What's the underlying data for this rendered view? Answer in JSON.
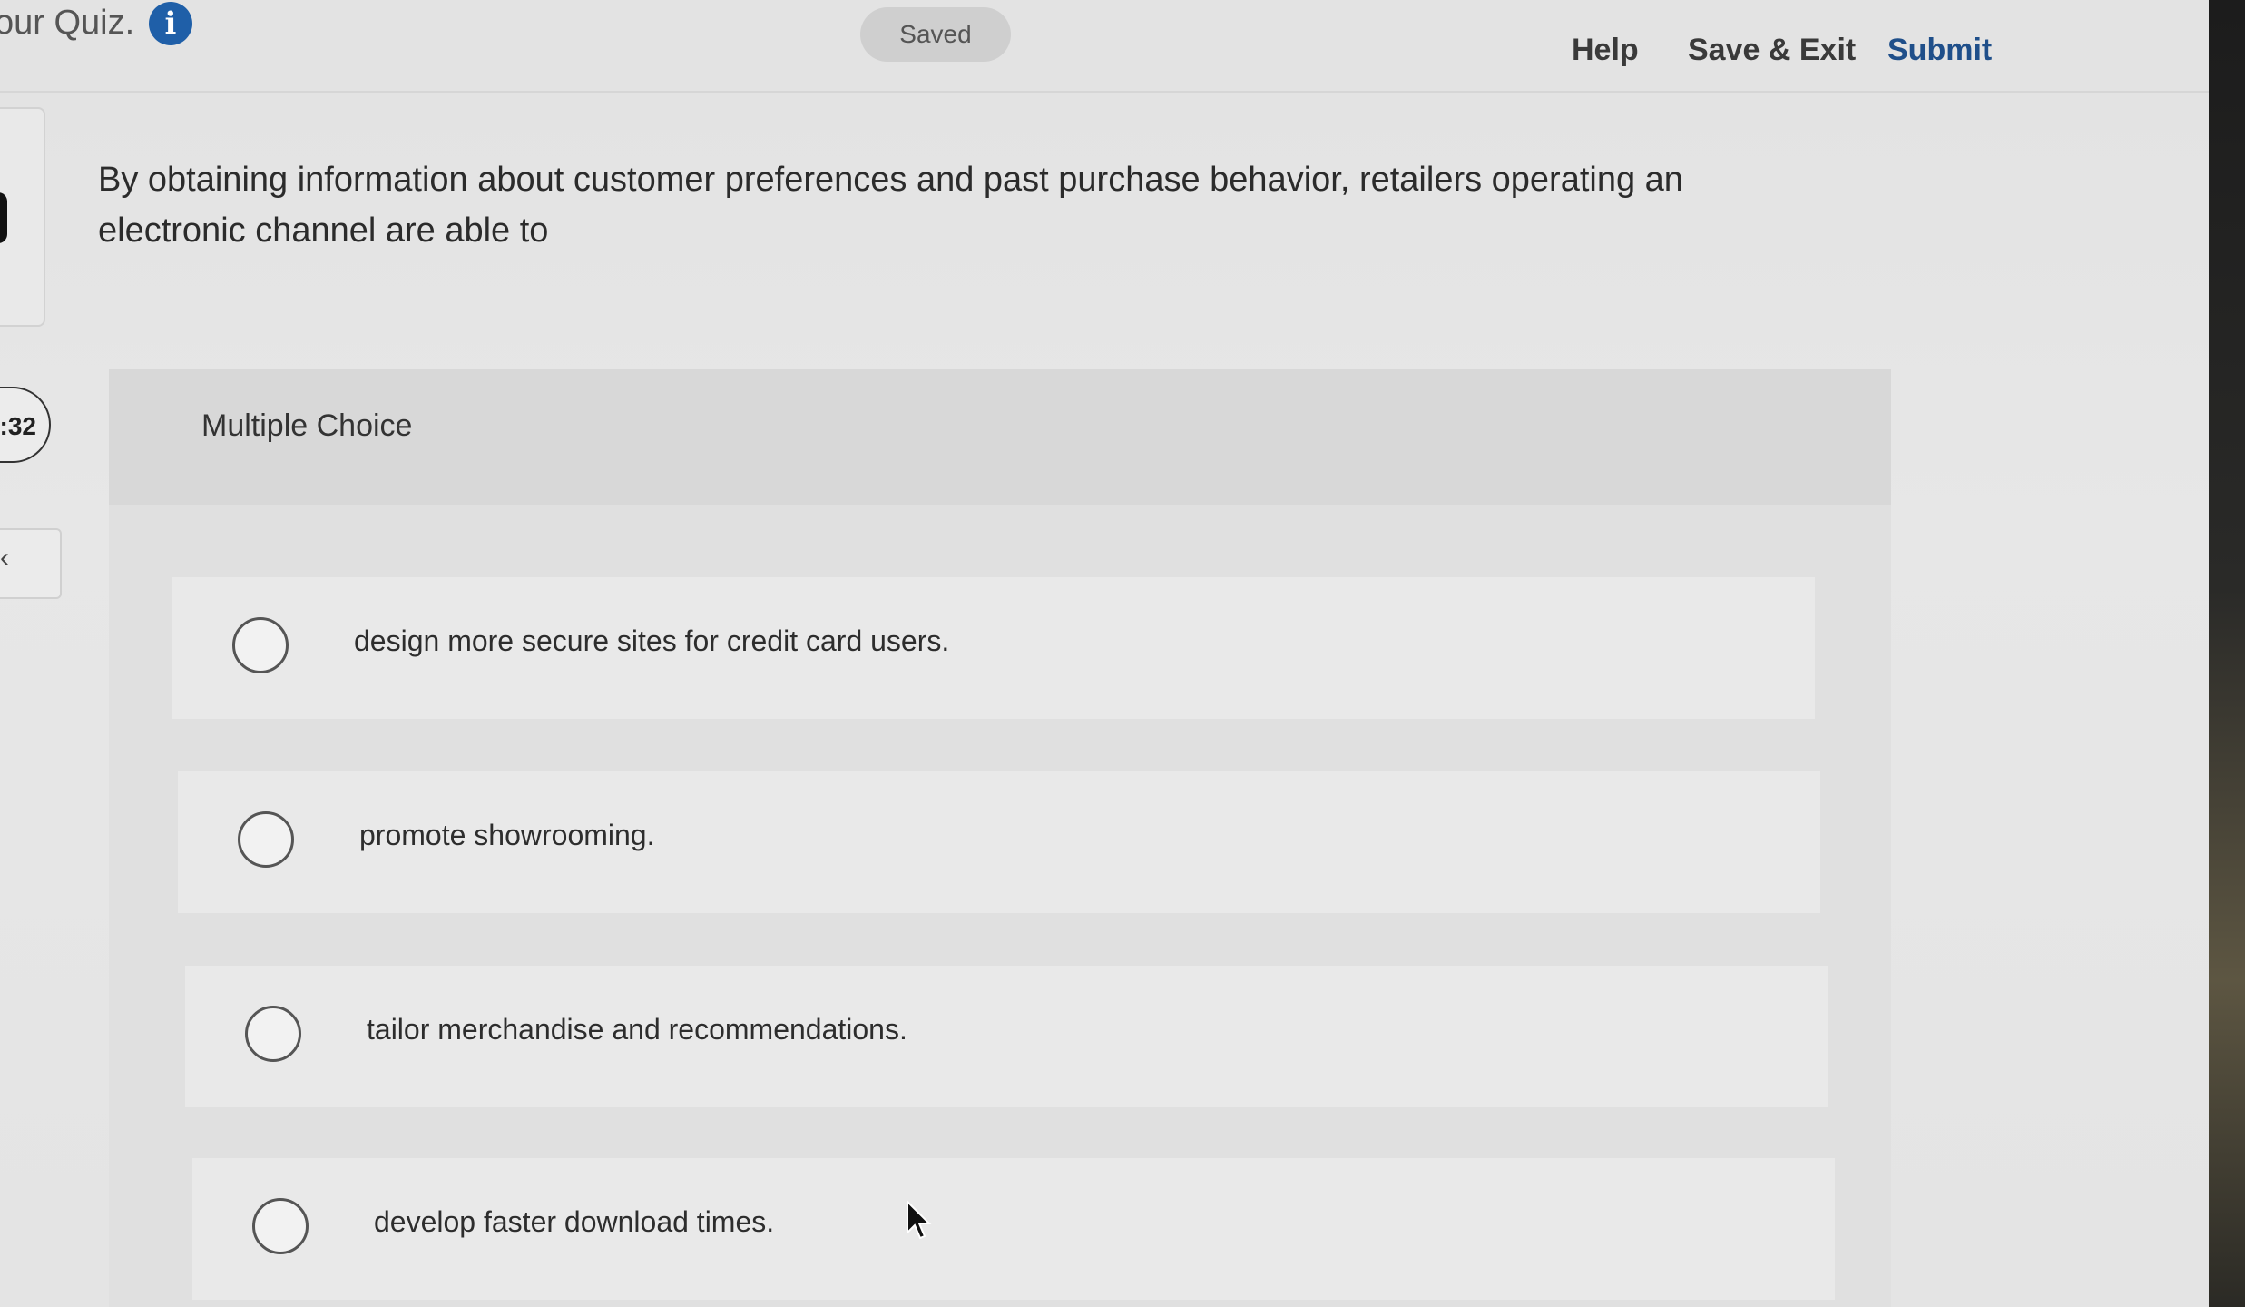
{
  "header": {
    "quiz_title": "our Quiz.",
    "saved_label": "Saved",
    "help_label": "Help",
    "save_exit_label": "Save & Exit",
    "submit_label": "Submit"
  },
  "sidebar": {
    "timer": ":32",
    "nav_glyph": "‹"
  },
  "question": {
    "text": "By obtaining information about customer preferences and past purchase behavior, retailers operating an electronic channel are able to"
  },
  "answer_panel": {
    "type_label": "Multiple Choice",
    "options": [
      {
        "label": "design more secure sites for credit card users."
      },
      {
        "label": "promote showrooming."
      },
      {
        "label": "tailor merchandise and recommendations."
      },
      {
        "label": "develop faster download times."
      }
    ]
  },
  "colors": {
    "info_icon": "#1f5fa8",
    "submit_text": "#1f4f8a"
  }
}
